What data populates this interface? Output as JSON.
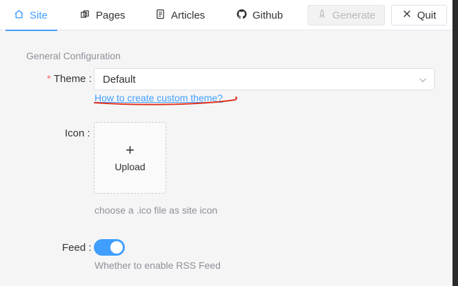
{
  "nav": {
    "tabs": [
      {
        "label": "Site",
        "icon": "home-icon"
      },
      {
        "label": "Pages",
        "icon": "pages-icon"
      },
      {
        "label": "Articles",
        "icon": "document-icon"
      },
      {
        "label": "Github",
        "icon": "github-icon"
      }
    ],
    "generate_label": "Generate",
    "quit_label": "Quit"
  },
  "form": {
    "section_title": "General Configuration",
    "theme": {
      "label": "Theme",
      "required_mark": "*",
      "value": "Default",
      "help_link": "How to create custom theme?"
    },
    "icon": {
      "label": "Icon",
      "upload_plus": "+",
      "upload_label": "Upload",
      "hint": "choose a .ico file as site icon"
    },
    "feed": {
      "label": "Feed",
      "enabled": true,
      "hint": "Whether to enable RSS Feed"
    }
  },
  "colors": {
    "accent": "#409eff",
    "required": "#f56c6c",
    "annotation": "#e0301e"
  }
}
